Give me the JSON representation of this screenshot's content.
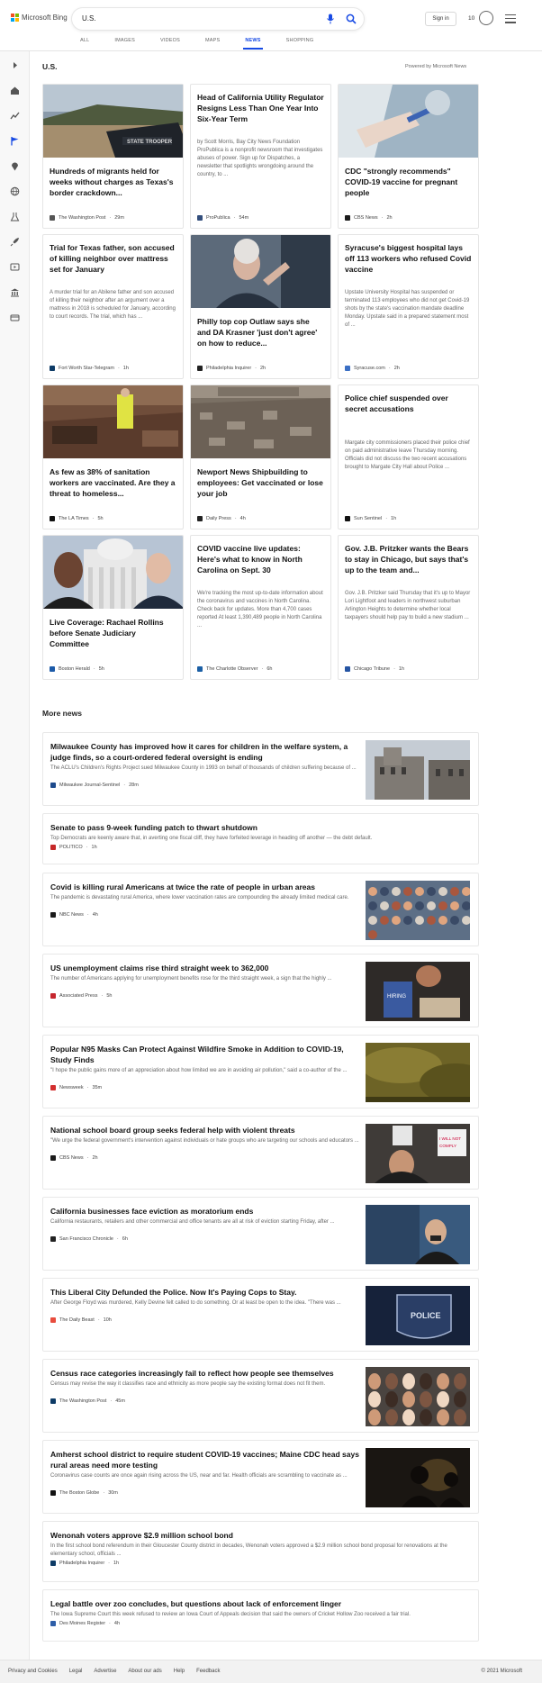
{
  "colors": {
    "accent": "#174ae4",
    "logo_red": "#f25022",
    "logo_green": "#7fba00",
    "logo_blue": "#00a4ef",
    "logo_yellow": "#ffb900"
  },
  "header": {
    "logo_text": "Microsoft Bing",
    "search_value": "U.S.",
    "signin_label": "Sign in",
    "rewards_count": "10",
    "tabs": [
      "ALL",
      "IMAGES",
      "VIDEOS",
      "MAPS",
      "NEWS",
      "SHOPPING"
    ],
    "active_tab": "NEWS"
  },
  "sidebar": {
    "icons": [
      "expand-icon",
      "home-icon",
      "trending-icon",
      "flag-icon",
      "location-icon",
      "globe-icon",
      "science-icon",
      "rocket-icon",
      "entertainment-icon",
      "building-icon",
      "money-icon"
    ]
  },
  "section": {
    "title": "U.S.",
    "powered_by": "Powered by Microsoft News"
  },
  "cards": [
    {
      "title": "Hundreds of migrants held for weeks without charges as Texas's border crackdown...",
      "snippet": "",
      "source": "The Washington Post",
      "time": "29m",
      "image": "state-trooper-photo"
    },
    {
      "title": "Head of California Utility Regulator Resigns Less Than One Year Into Six-Year Term",
      "snippet": "by Scott Morris, Bay City News Foundation ProPublica is a nonprofit newsroom that investigates abuses of power. Sign up for Dispatches, a newsletter that spotlights wrongdoing around the country, to ...",
      "source": "ProPublica",
      "time": "54m",
      "image": ""
    },
    {
      "title": "CDC \"strongly recommends\" COVID-19 vaccine for pregnant people",
      "snippet": "",
      "source": "CBS News",
      "time": "2h",
      "image": "vaccine-photo"
    },
    {
      "title": "Trial for Texas father, son accused of killing neighbor over mattress set for January",
      "snippet": "A murder trial for an Abilene father and son accused of killing their neighbor after an argument over a mattress in 2018 is scheduled for January, according to court records. The trial, which has ...",
      "source": "Fort Worth Star-Telegram",
      "time": "1h",
      "image": ""
    },
    {
      "title": "Philly top cop Outlaw says she and DA Krasner 'just don't agree' on how to reduce...",
      "snippet": "",
      "source": "Philadelphia Inquirer",
      "time": "2h",
      "image": "krasner-photo"
    },
    {
      "title": "Syracuse's biggest hospital lays off 113 workers who refused Covid vaccine",
      "snippet": "Upstate University Hospital has suspended or terminated 113 employees who did not get Covid-19 shots by the state's vaccination mandate deadline Monday. Upstate said in a prepared statement most of ...",
      "source": "Syracuse.com",
      "time": "2h",
      "image": ""
    },
    {
      "title": "As few as 38% of sanitation workers are vaccinated. Are they a threat to homeless...",
      "snippet": "",
      "source": "The LA Times",
      "time": "5h",
      "image": "sanitation-photo"
    },
    {
      "title": "Newport News Shipbuilding to employees: Get vaccinated or lose your job",
      "snippet": "",
      "source": "Daily Press",
      "time": "4h",
      "image": "shipyard-photo"
    },
    {
      "title": "Police chief suspended over secret accusations",
      "snippet": "Margate city commissioners placed their police chief on paid administrative leave Thursday morning. Officials did not discuss the two recent accusations brought to Margate City Hall about Police ...",
      "source": "Sun Sentinel",
      "time": "1h",
      "image": ""
    },
    {
      "title": "Live Coverage: Rachael Rollins before Senate Judiciary Committee",
      "snippet": "",
      "source": "Boston Herald",
      "time": "5h",
      "image": "rollins-photo"
    },
    {
      "title": "COVID vaccine live updates: Here's what to know in North Carolina on Sept. 30",
      "snippet": "We're tracking the most up-to-date information about the coronavirus and vaccines in North Carolina. Check back for updates. More than 4,700 cases reported At least 1,390,489 people in North Carolina ...",
      "source": "The Charlotte Observer",
      "time": "6h",
      "image": ""
    },
    {
      "title": "Gov. J.B. Pritzker wants the Bears to stay in Chicago, but says that's up to the team and...",
      "snippet": "Gov. J.B. Pritzker said Thursday that it's up to Mayor Lori Lightfoot and leaders in northwest suburban Arlington Heights to determine whether local taxpayers should help pay to build a new stadium ...",
      "source": "Chicago Tribune",
      "time": "1h",
      "image": ""
    }
  ],
  "more_news": {
    "title": "More news",
    "items": [
      {
        "title": "Milwaukee County has improved how it cares for children in the welfare system, a judge finds, so a court-ordered federal oversight is ending",
        "snippet": "The ACLU's Children's Rights Project sued Milwaukee County in 1993 on behalf of thousands of children suffering because of ...",
        "source": "Milwaukee Journal-Sentinel",
        "time": "28m",
        "thumb": "courthouse-photo"
      },
      {
        "title": "Senate to pass 9-week funding patch to thwart shutdown",
        "snippet": "Top Democrats are keenly aware that, in averting one fiscal cliff, they have forfeited leverage in heading off another — the debt default.",
        "source": "POLITICO",
        "time": "1h",
        "thumb": ""
      },
      {
        "title": "Covid is killing rural Americans at twice the rate of people in urban areas",
        "snippet": "The pandemic is devastating rural America, where lower vaccination rates are compounding the already limited medical care.",
        "source": "NBC News",
        "time": "4h",
        "thumb": "crowd-photo"
      },
      {
        "title": "US unemployment claims rise third straight week to 362,000",
        "snippet": "The number of Americans applying for unemployment benefits rose for the third straight week, a sign that the highly ...",
        "source": "Associated Press",
        "time": "5h",
        "thumb": "hiring-sign-photo"
      },
      {
        "title": "Popular N95 Masks Can Protect Against Wildfire Smoke in Addition to COVID-19, Study Finds",
        "snippet": "\"I hope the public gains more of an appreciation about how limited we are in avoiding air pollution,\" said a co-author of the ...",
        "source": "Newsweek",
        "time": "35m",
        "thumb": "smoke-photo"
      },
      {
        "title": "National school board group seeks federal help with violent threats",
        "snippet": "\"We urge the federal government's intervention against individuals or hate groups who are targeting our schools and educators ...",
        "source": "CBS News",
        "time": "2h",
        "thumb": "protest-photo"
      },
      {
        "title": "California businesses face eviction as moratorium ends",
        "snippet": "California restaurants, retailers and other commercial and office tenants are all at risk of eviction starting Friday, after ...",
        "source": "San Francisco Chronicle",
        "time": "6h",
        "thumb": "restaurant-photo"
      },
      {
        "title": "This Liberal City Defunded the Police. Now It's Paying Cops to Stay.",
        "snippet": "After George Floyd was murdered, Kelly Devine felt called to do something. Or at least be open to the idea. \"There was ...",
        "source": "The Daily Beast",
        "time": "10h",
        "thumb": "police-patch-photo"
      },
      {
        "title": "Census race categories increasingly fail to reflect how people see themselves",
        "snippet": "Census may revise the way it classifies race and ethnicity as more people say the existing format does not fit them.",
        "source": "The Washington Post",
        "time": "45m",
        "thumb": "street-crowd-photo"
      },
      {
        "title": "Amherst school district to require student COVID-19 vaccines; Maine CDC head says rural areas need more testing",
        "snippet": "Coronavirus case counts are once again rising across the US, near and far. Health officials are scrambling to vaccinate as ...",
        "source": "The Boston Globe",
        "time": "30m",
        "thumb": "silhouette-photo"
      },
      {
        "title": "Wenonah voters approve $2.9 million school bond",
        "snippet": "In the first school bond referendum in their Gloucester County district in decades, Wenonah voters approved a $2.9 million school bond proposal for renovations at the elementary school, officials ...",
        "source": "Philadelphia Inquirer",
        "time": "1h",
        "thumb": ""
      },
      {
        "title": "Legal battle over zoo concludes, but questions about lack of enforcement linger",
        "snippet": "The Iowa Supreme Court this week refused to review an Iowa Court of Appeals decision that said the owners of Cricket Hollow Zoo received a fair trial.",
        "source": "Des Moines Register",
        "time": "4h",
        "thumb": ""
      }
    ]
  },
  "footer": {
    "links": [
      "Privacy and Cookies",
      "Legal",
      "Advertise",
      "About our ads",
      "Help",
      "Feedback"
    ],
    "copyright": "© 2021 Microsoft"
  }
}
